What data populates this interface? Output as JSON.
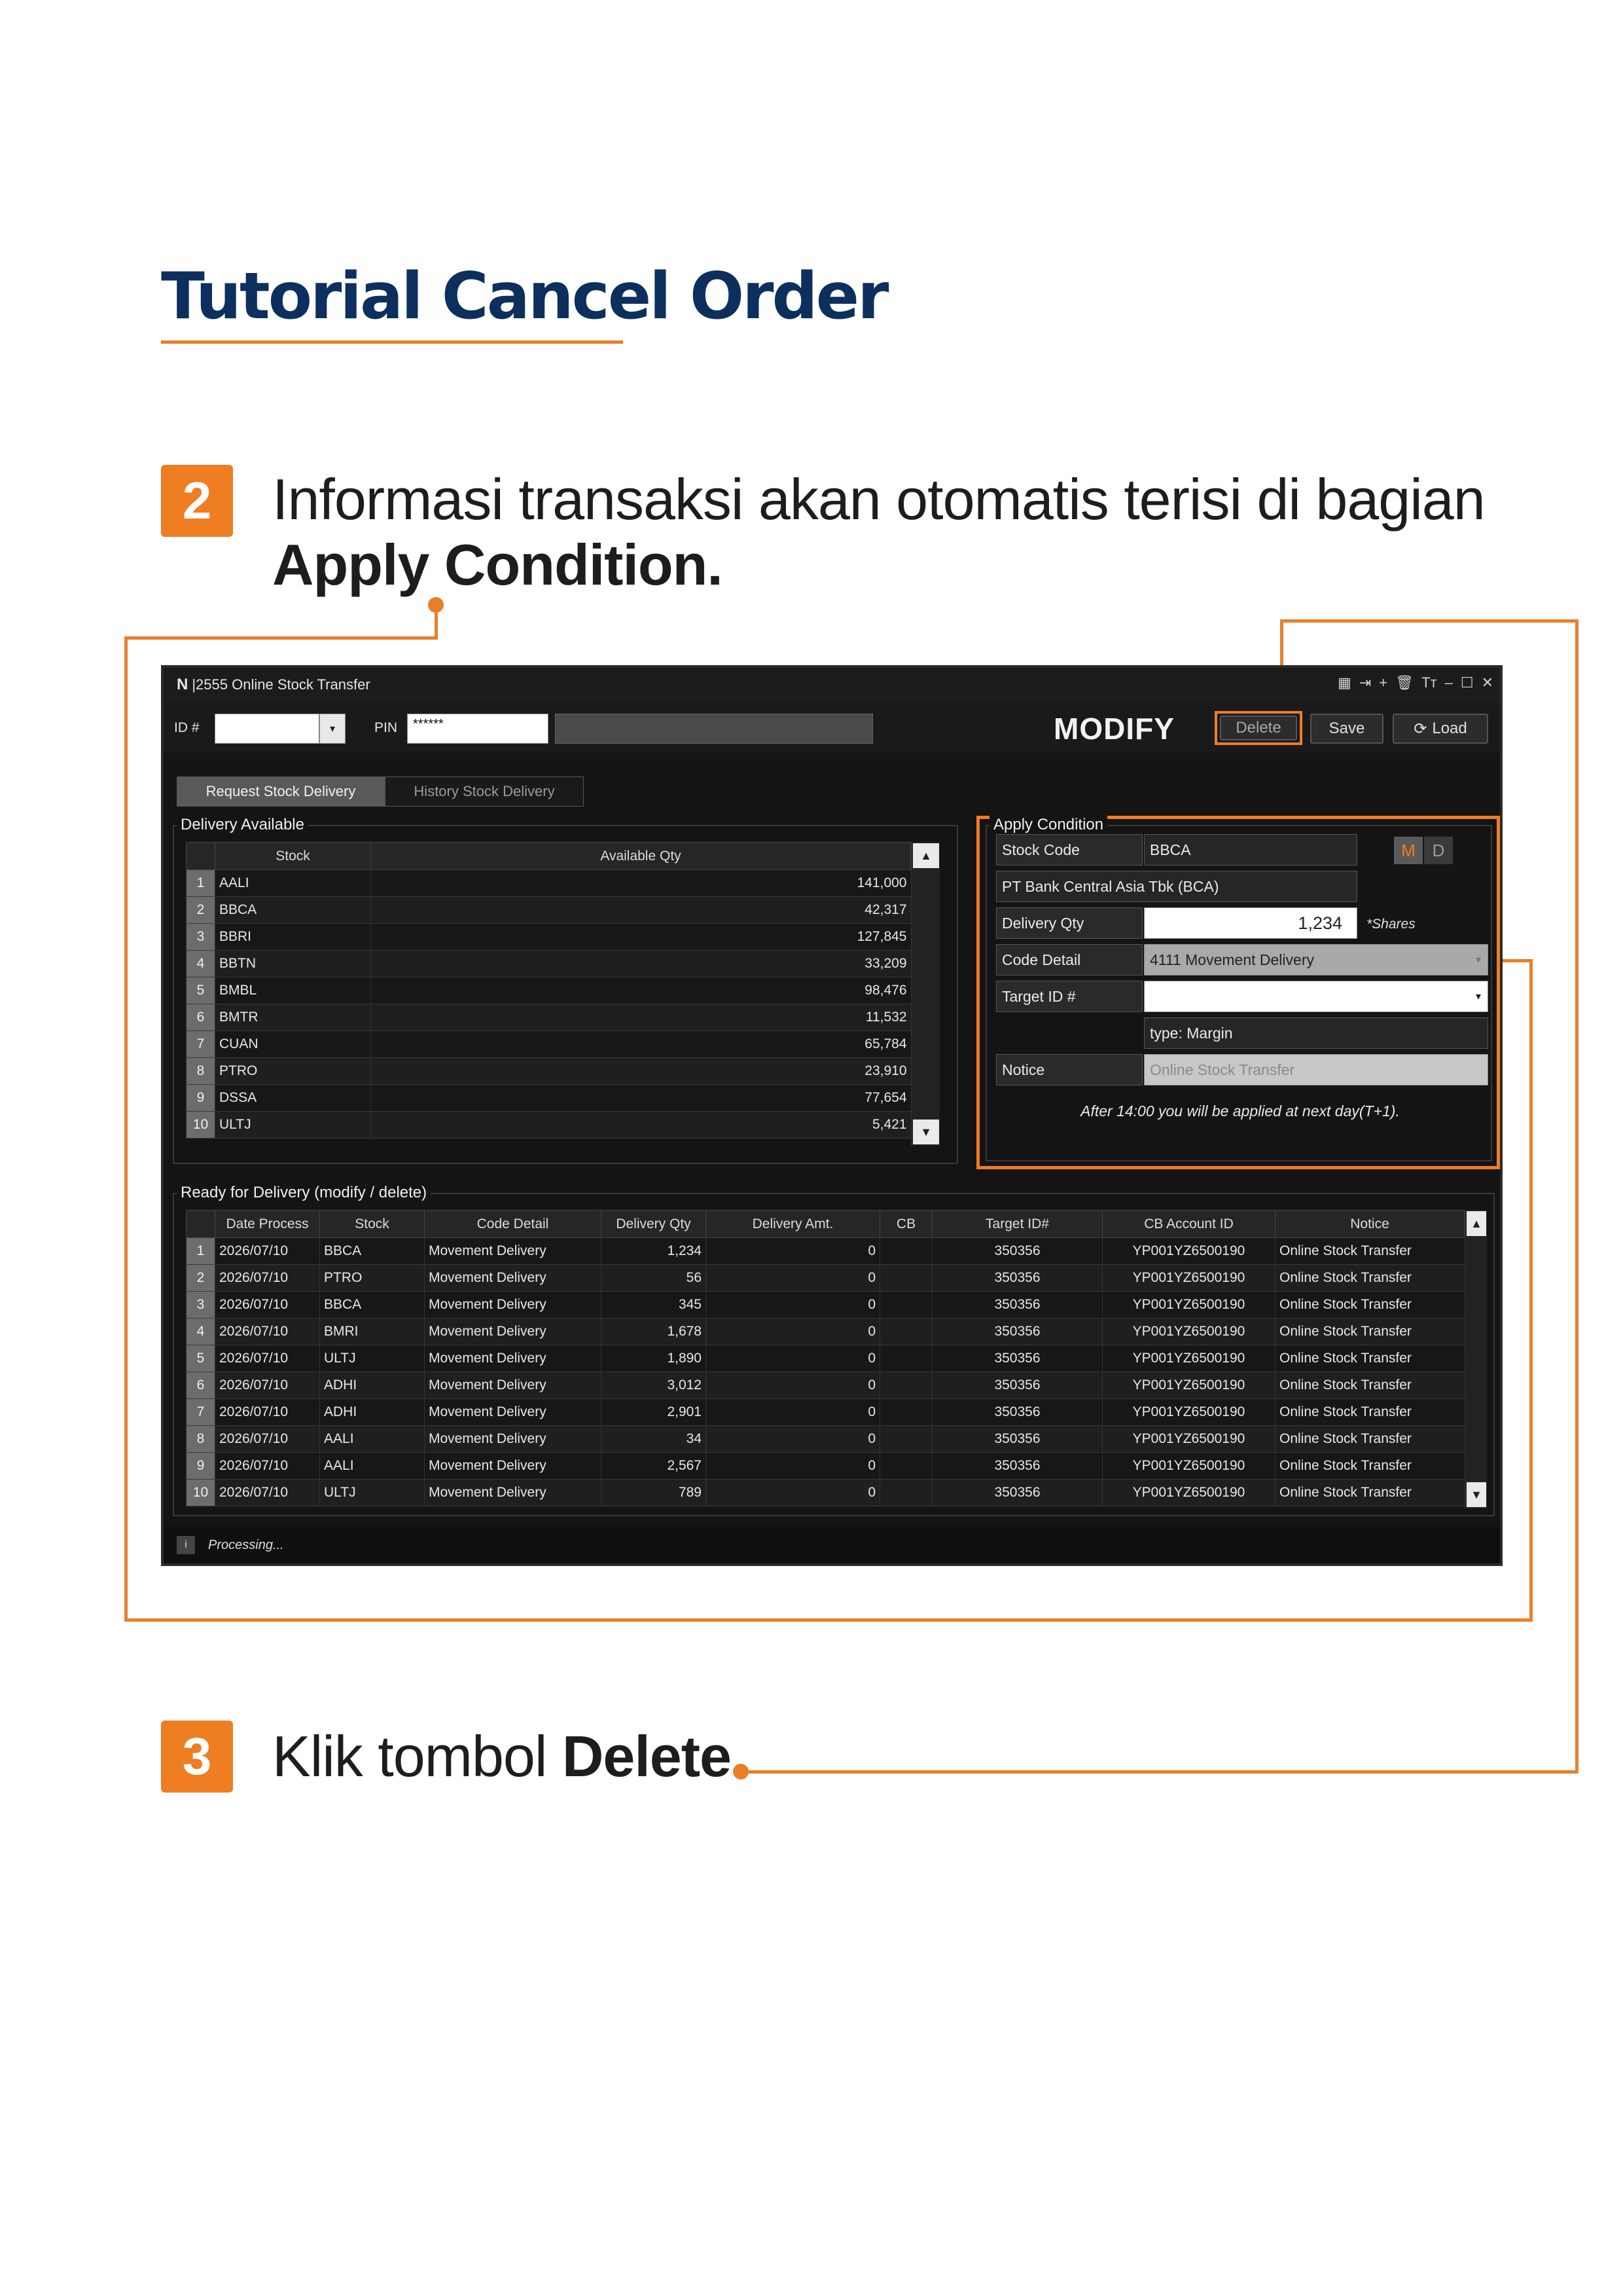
{
  "heading": {
    "title": "Tutorial Cancel Order"
  },
  "steps": [
    {
      "number": "2",
      "text": "Informasi transaksi akan otomatis terisi di bagian",
      "bold": "Apply Condition."
    },
    {
      "number": "3",
      "text": "Klik tombol",
      "bold": "Delete."
    }
  ],
  "colors": {
    "accent": "#ef7d22",
    "title": "#0d2f5e",
    "window_bg": "#141414"
  },
  "window": {
    "logo": "N",
    "title": "|2555 Online Stock Transfer",
    "controls": [
      "grid-icon",
      "exit-icon",
      "plus-icon",
      "trash-icon",
      "font-size-icon",
      "minimize-icon",
      "maximize-icon",
      "close-icon"
    ]
  },
  "toolbar": {
    "id_label": "ID #",
    "id_value": "",
    "pin_label": "PIN",
    "pin_value": "******",
    "mode": "MODIFY",
    "delete_label": "Delete",
    "save_label": "Save",
    "load_label": "Load"
  },
  "tabs": [
    {
      "label": "Request Stock Delivery",
      "active": true
    },
    {
      "label": "History Stock Delivery",
      "active": false
    }
  ],
  "delivery_available": {
    "title": "Delivery Available",
    "columns": [
      "Stock",
      "Available Qty"
    ],
    "rows": [
      {
        "no": "1",
        "stock": "AALI",
        "qty": "141,000"
      },
      {
        "no": "2",
        "stock": "BBCA",
        "qty": "42,317"
      },
      {
        "no": "3",
        "stock": "BBRI",
        "qty": "127,845"
      },
      {
        "no": "4",
        "stock": "BBTN",
        "qty": "33,209"
      },
      {
        "no": "5",
        "stock": "BMBL",
        "qty": "98,476"
      },
      {
        "no": "6",
        "stock": "BMTR",
        "qty": "11,532"
      },
      {
        "no": "7",
        "stock": "CUAN",
        "qty": "65,784"
      },
      {
        "no": "8",
        "stock": "PTRO",
        "qty": "23,910"
      },
      {
        "no": "9",
        "stock": "DSSA",
        "qty": "77,654"
      },
      {
        "no": "10",
        "stock": "ULTJ",
        "qty": "5,421"
      }
    ]
  },
  "apply_condition": {
    "title": "Apply Condition",
    "stock_code_label": "Stock Code",
    "stock_code_value": "BBCA",
    "mode_m": "M",
    "mode_d": "D",
    "company_name": "PT Bank Central Asia Tbk (BCA)",
    "delivery_qty_label": "Delivery Qty",
    "delivery_qty_value": "1,234",
    "shares_unit": "*Shares",
    "code_detail_label": "Code Detail",
    "code_detail_value": "4111 Movement Delivery",
    "target_id_label": "Target ID #",
    "target_id_value": "",
    "type_value": "type: Margin",
    "notice_label": "Notice",
    "notice_placeholder": "Online Stock Transfer",
    "footer_note": "After 14:00 you will be applied at next day(T+1)."
  },
  "ready_for_delivery": {
    "title": "Ready for Delivery (modify / delete)",
    "columns": [
      "Date Process",
      "Stock",
      "Code Detail",
      "Delivery Qty",
      "Delivery Amt.",
      "CB",
      "Target ID#",
      "CB Account ID",
      "Notice"
    ],
    "rows": [
      {
        "no": "1",
        "date": "2026/07/10",
        "stock": "BBCA",
        "code": "Movement Delivery",
        "qty": "1,234",
        "amt": "0",
        "cb": "",
        "target": "350356",
        "account": "YP001YZ6500190",
        "notice": "Online Stock Transfer"
      },
      {
        "no": "2",
        "date": "2026/07/10",
        "stock": "PTRO",
        "code": "Movement Delivery",
        "qty": "56",
        "amt": "0",
        "cb": "",
        "target": "350356",
        "account": "YP001YZ6500190",
        "notice": "Online Stock Transfer"
      },
      {
        "no": "3",
        "date": "2026/07/10",
        "stock": "BBCA",
        "code": "Movement Delivery",
        "qty": "345",
        "amt": "0",
        "cb": "",
        "target": "350356",
        "account": "YP001YZ6500190",
        "notice": "Online Stock Transfer"
      },
      {
        "no": "4",
        "date": "2026/07/10",
        "stock": "BMRI",
        "code": "Movement Delivery",
        "qty": "1,678",
        "amt": "0",
        "cb": "",
        "target": "350356",
        "account": "YP001YZ6500190",
        "notice": "Online Stock Transfer"
      },
      {
        "no": "5",
        "date": "2026/07/10",
        "stock": "ULTJ",
        "code": "Movement Delivery",
        "qty": "1,890",
        "amt": "0",
        "cb": "",
        "target": "350356",
        "account": "YP001YZ6500190",
        "notice": "Online Stock Transfer"
      },
      {
        "no": "6",
        "date": "2026/07/10",
        "stock": "ADHI",
        "code": "Movement Delivery",
        "qty": "3,012",
        "amt": "0",
        "cb": "",
        "target": "350356",
        "account": "YP001YZ6500190",
        "notice": "Online Stock Transfer"
      },
      {
        "no": "7",
        "date": "2026/07/10",
        "stock": "ADHI",
        "code": "Movement Delivery",
        "qty": "2,901",
        "amt": "0",
        "cb": "",
        "target": "350356",
        "account": "YP001YZ6500190",
        "notice": "Online Stock Transfer"
      },
      {
        "no": "8",
        "date": "2026/07/10",
        "stock": "AALI",
        "code": "Movement Delivery",
        "qty": "34",
        "amt": "0",
        "cb": "",
        "target": "350356",
        "account": "YP001YZ6500190",
        "notice": "Online Stock Transfer"
      },
      {
        "no": "9",
        "date": "2026/07/10",
        "stock": "AALI",
        "code": "Movement Delivery",
        "qty": "2,567",
        "amt": "0",
        "cb": "",
        "target": "350356",
        "account": "YP001YZ6500190",
        "notice": "Online Stock Transfer"
      },
      {
        "no": "10",
        "date": "2026/07/10",
        "stock": "ULTJ",
        "code": "Movement Delivery",
        "qty": "789",
        "amt": "0",
        "cb": "",
        "target": "350356",
        "account": "YP001YZ6500190",
        "notice": "Online Stock Transfer"
      }
    ]
  },
  "status": {
    "icon": "i",
    "text": "Processing..."
  }
}
